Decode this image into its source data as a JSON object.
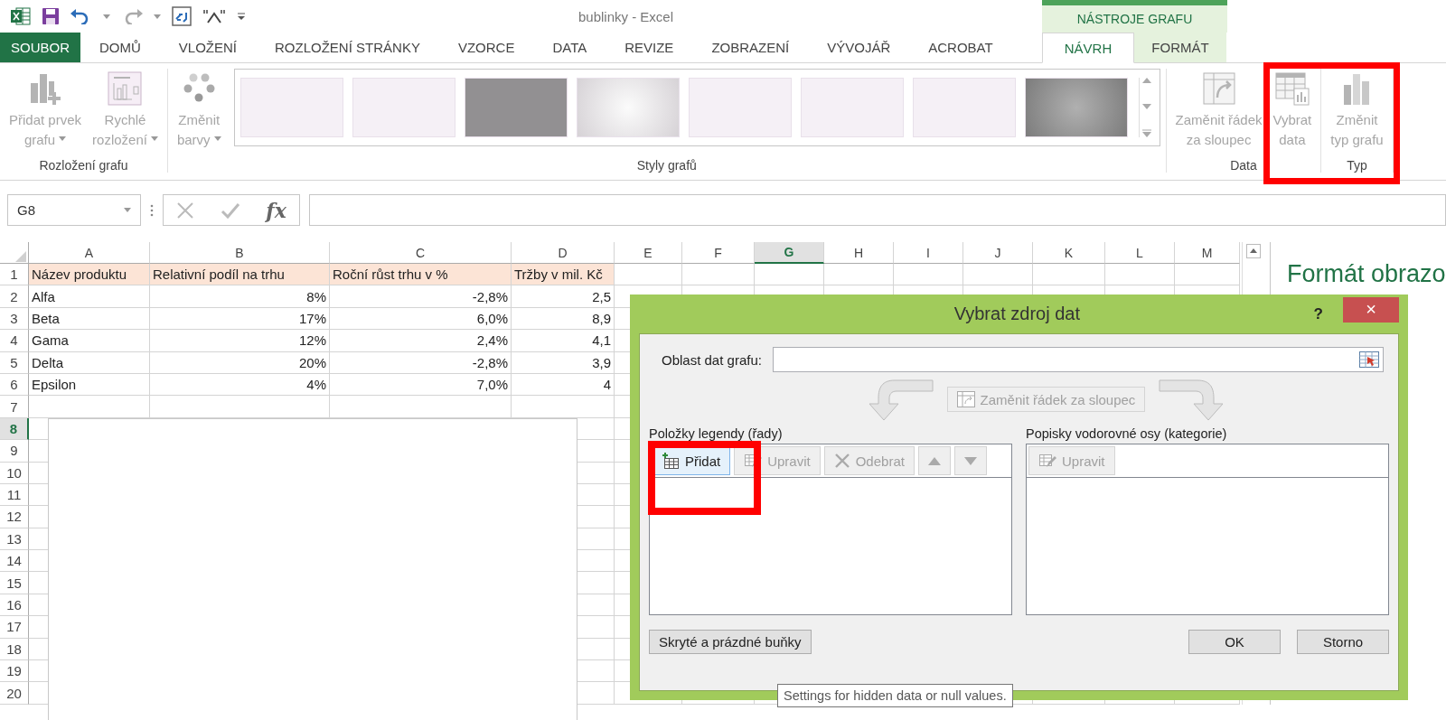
{
  "window": {
    "title": "bublinky - Excel",
    "context_group": "NÁSTROJE GRAFU"
  },
  "tabs": [
    {
      "label": "SOUBOR",
      "kind": "file",
      "selected": false
    },
    {
      "label": "DOMŮ",
      "kind": "main",
      "selected": false
    },
    {
      "label": "VLOŽENÍ",
      "kind": "main",
      "selected": false
    },
    {
      "label": "ROZLOŽENÍ STRÁNKY",
      "kind": "main",
      "selected": false
    },
    {
      "label": "VZORCE",
      "kind": "main",
      "selected": false
    },
    {
      "label": "DATA",
      "kind": "main",
      "selected": false
    },
    {
      "label": "REVIZE",
      "kind": "main",
      "selected": false
    },
    {
      "label": "ZOBRAZENÍ",
      "kind": "main",
      "selected": false
    },
    {
      "label": "VÝVOJÁŘ",
      "kind": "main",
      "selected": false
    },
    {
      "label": "ACROBAT",
      "kind": "main",
      "selected": false
    },
    {
      "label": "NÁVRH",
      "kind": "context",
      "selected": true
    },
    {
      "label": "FORMÁT",
      "kind": "context",
      "selected": false
    }
  ],
  "ribbon": {
    "groups": [
      {
        "label": "Rozložení grafu",
        "buttons": [
          {
            "kind": "add-element",
            "lines": [
              "Přidat prvek",
              "grafu"
            ],
            "dropdown": true,
            "disabled": true
          },
          {
            "kind": "quick-layout",
            "lines": [
              "Rychlé",
              "rozložení"
            ],
            "dropdown": true,
            "disabled": true
          }
        ]
      },
      {
        "label": "Styly grafů",
        "buttons": [
          {
            "kind": "colors",
            "lines": [
              "Změnit",
              "barvy"
            ],
            "dropdown": true,
            "disabled": true
          }
        ],
        "styles": [
          {
            "kind": "light"
          },
          {
            "kind": "light"
          },
          {
            "kind": "dark"
          },
          {
            "kind": "gradient"
          },
          {
            "kind": "light"
          },
          {
            "kind": "light"
          },
          {
            "kind": "light"
          },
          {
            "kind": "dark-gradient"
          }
        ]
      },
      {
        "label": "Data",
        "buttons": [
          {
            "kind": "switch",
            "lines": [
              "Zaměnit řádek",
              "za sloupec"
            ],
            "dropdown": false,
            "disabled": true
          },
          {
            "kind": "select-data",
            "lines": [
              "Vybrat",
              "data"
            ],
            "dropdown": false,
            "disabled": true
          }
        ]
      },
      {
        "label": "Typ",
        "buttons": [
          {
            "kind": "change-type",
            "lines": [
              "Změnit",
              "typ grafu"
            ],
            "dropdown": false,
            "disabled": true
          }
        ]
      }
    ]
  },
  "formula_bar": {
    "cell": "G8",
    "function_label": "fx"
  },
  "sheet": {
    "columns": [
      {
        "label": "A",
        "selected": false
      },
      {
        "label": "B",
        "selected": false
      },
      {
        "label": "C",
        "selected": false
      },
      {
        "label": "D",
        "selected": false
      },
      {
        "label": "E",
        "selected": false
      },
      {
        "label": "F",
        "selected": false
      },
      {
        "label": "G",
        "selected": true
      },
      {
        "label": "H",
        "selected": false
      },
      {
        "label": "I",
        "selected": false
      },
      {
        "label": "J",
        "selected": false
      },
      {
        "label": "K",
        "selected": false
      },
      {
        "label": "L",
        "selected": false
      },
      {
        "label": "M",
        "selected": false
      }
    ],
    "rows": [
      {
        "number": "1",
        "selected": false,
        "kind": "header",
        "cells": [
          "Název produktu",
          "Relativní podíl na trhu",
          "Roční růst trhu v %",
          "Tržby v mil. Kč"
        ]
      },
      {
        "number": "2",
        "selected": false,
        "kind": "data",
        "cells": [
          "Alfa",
          "8%",
          "-2,8%",
          "2,5"
        ]
      },
      {
        "number": "3",
        "selected": false,
        "kind": "data",
        "cells": [
          "Beta",
          "17%",
          "6,0%",
          "8,9"
        ]
      },
      {
        "number": "4",
        "selected": false,
        "kind": "data",
        "cells": [
          "Gama",
          "12%",
          "2,4%",
          "4,1"
        ]
      },
      {
        "number": "5",
        "selected": false,
        "kind": "data",
        "cells": [
          "Delta",
          "20%",
          "-2,8%",
          "3,9"
        ]
      },
      {
        "number": "6",
        "selected": false,
        "kind": "data",
        "cells": [
          "Epsilon",
          "4%",
          "7,0%",
          "4"
        ]
      },
      {
        "number": "7",
        "selected": false,
        "kind": "blank"
      },
      {
        "number": "8",
        "selected": true,
        "kind": "blank"
      },
      {
        "number": "9",
        "selected": false,
        "kind": "blank"
      },
      {
        "number": "10",
        "selected": false,
        "kind": "blank"
      },
      {
        "number": "11",
        "selected": false,
        "kind": "blank"
      },
      {
        "number": "12",
        "selected": false,
        "kind": "blank"
      },
      {
        "number": "13",
        "selected": false,
        "kind": "blank"
      },
      {
        "number": "14",
        "selected": false,
        "kind": "blank"
      },
      {
        "number": "15",
        "selected": false,
        "kind": "blank"
      },
      {
        "number": "16",
        "selected": false,
        "kind": "blank"
      },
      {
        "number": "17",
        "selected": false,
        "kind": "blank"
      },
      {
        "number": "18",
        "selected": false,
        "kind": "blank"
      },
      {
        "number": "19",
        "selected": false,
        "kind": "blank"
      },
      {
        "number": "20",
        "selected": false,
        "kind": "blank"
      }
    ]
  },
  "side_pane": {
    "title": "Formát obrazo"
  },
  "dialog": {
    "title": "Vybrat zdroj dat",
    "help": "?",
    "close": "×",
    "range_label": "Oblast dat grafu:",
    "switch_button": {
      "label": "Zaměnit řádek za sloupec",
      "disabled": true
    },
    "legend": {
      "label": "Položky legendy (řady)",
      "buttons": [
        {
          "kind": "add",
          "label": "Přidat",
          "disabled": false
        },
        {
          "kind": "edit",
          "label": "Upravit",
          "disabled": true
        },
        {
          "kind": "remove",
          "label": "Odebrat",
          "disabled": true
        },
        {
          "kind": "up",
          "disabled": true
        },
        {
          "kind": "down",
          "disabled": true
        }
      ]
    },
    "axis": {
      "label": "Popisky vodorovné osy (kategorie)",
      "buttons": [
        {
          "kind": "edit",
          "label": "Upravit",
          "disabled": true
        }
      ]
    },
    "hidden_cells_button": "Skryté a prázdné buňky",
    "ok_button": "OK",
    "cancel_button": "Storno"
  },
  "tooltip": "Settings for hidden data or null values."
}
